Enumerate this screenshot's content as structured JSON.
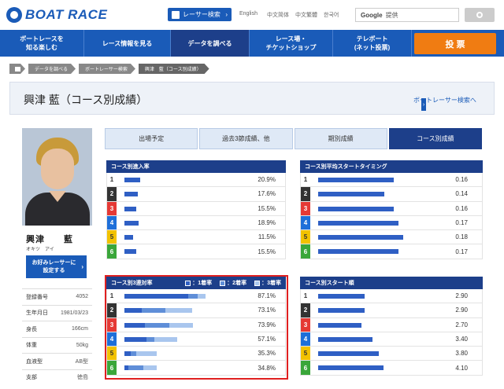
{
  "header": {
    "logo_text": "BOAT RACE",
    "racer_search": "レーサー検索",
    "languages": [
      "English",
      "中文简体",
      "中文繁體",
      "한국어"
    ],
    "search_brand": "Google",
    "search_placeholder": "提供"
  },
  "nav": {
    "items": [
      {
        "label": "ボートレースを\n知る楽しむ"
      },
      {
        "label": "レース情報を見る"
      },
      {
        "label": "データを調べる"
      },
      {
        "label": "レース場・\nチケットショップ"
      },
      {
        "label": "テレボート\n(ネット投票)"
      }
    ],
    "cta": "投 票"
  },
  "breadcrumb": [
    "データを調べる",
    "ボートレーサー検索",
    "興津　藍（コース別成績）"
  ],
  "title": "興津 藍（コース別成績）",
  "back_link": "ボートレーサー検索へ",
  "racer": {
    "name": "興津　　藍",
    "kana": "オキツ　アイ",
    "fav_button": "お好みレーサーに\n設定する",
    "profile": [
      {
        "k": "登録番号",
        "v": "4052"
      },
      {
        "k": "生年月日",
        "v": "1981/03/23"
      },
      {
        "k": "身長",
        "v": "166cm"
      },
      {
        "k": "体重",
        "v": "50kg"
      },
      {
        "k": "血液型",
        "v": "AB型"
      },
      {
        "k": "支部",
        "v": "徳島"
      }
    ]
  },
  "tabs": [
    "出場予定",
    "過去3節成績、他",
    "期別成績",
    "コース別成績"
  ],
  "colors": {
    "nav": "#1a5bb8",
    "dark": "#1d3f8a",
    "cta": "#f07c12",
    "bar1": "#2f5fc4",
    "bar2": "#5f8ed8",
    "bar3": "#a9c6ee"
  },
  "lanes": {
    "labels": [
      "1",
      "2",
      "3",
      "4",
      "5",
      "6"
    ],
    "bg": [
      "#ffffff",
      "#333333",
      "#e53935",
      "#1e6fd9",
      "#f2c200",
      "#3aa63a"
    ],
    "fg": [
      "#333333",
      "#ffffff",
      "#ffffff",
      "#ffffff",
      "#333333",
      "#ffffff"
    ]
  },
  "course_entry": {
    "title": "コース別進入率",
    "values": [
      "20.9%",
      "17.6%",
      "15.5%",
      "18.9%",
      "11.5%",
      "15.5%"
    ],
    "fractions": [
      0.209,
      0.176,
      0.155,
      0.189,
      0.115,
      0.155
    ]
  },
  "avg_start": {
    "title": "コース別平均スタートタイミング",
    "values": [
      "0.16",
      "0.14",
      "0.16",
      "0.17",
      "0.18",
      "0.17"
    ],
    "numbers": [
      0.16,
      0.14,
      0.16,
      0.17,
      0.18,
      0.17
    ]
  },
  "top3": {
    "title": "コース別3連対率",
    "legend": [
      "：1着率",
      "：2着率",
      "：3着率"
    ],
    "values": [
      "87.1%",
      "73.1%",
      "73.9%",
      "57.1%",
      "35.3%",
      "34.8%"
    ],
    "segments": [
      [
        0.69,
        0.1,
        0.08
      ],
      [
        0.19,
        0.25,
        0.29
      ],
      [
        0.22,
        0.26,
        0.26
      ],
      [
        0.24,
        0.08,
        0.25
      ],
      [
        0.07,
        0.06,
        0.22
      ],
      [
        0.04,
        0.16,
        0.15
      ]
    ]
  },
  "start_rank": {
    "title": "コース別スタート順",
    "values": [
      "2.90",
      "2.90",
      "2.70",
      "3.40",
      "3.80",
      "4.10"
    ],
    "numbers": [
      2.9,
      2.9,
      2.7,
      3.4,
      3.8,
      4.1
    ]
  }
}
